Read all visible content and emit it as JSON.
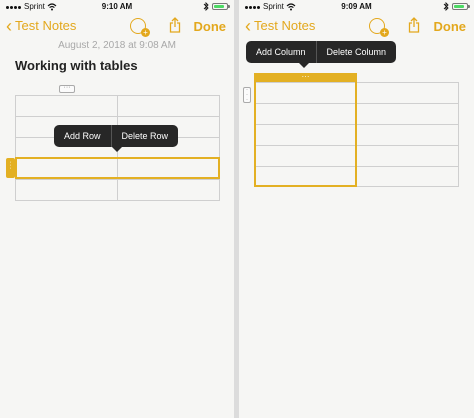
{
  "left": {
    "status": {
      "carrier": "Sprint",
      "time": "9:10 AM",
      "battery_level": 0.85
    },
    "nav": {
      "back_label": "Test Notes",
      "done_label": "Done"
    },
    "note": {
      "date": "August 2, 2018 at 9:08 AM",
      "title": "Working with tables"
    },
    "menu": {
      "add_row": "Add Row",
      "delete_row": "Delete Row"
    }
  },
  "right": {
    "status": {
      "carrier": "Sprint",
      "time": "9:09 AM",
      "battery_level": 0.85
    },
    "nav": {
      "back_label": "Test Notes",
      "done_label": "Done"
    },
    "menu": {
      "add_column": "Add Column",
      "delete_column": "Delete Column"
    }
  },
  "colors": {
    "accent": "#e3a81d",
    "selection": "#e3b023",
    "menu_bg": "#272727",
    "battery": "#4cd964"
  },
  "icons": [
    "back-chevron-icon",
    "add-people-icon",
    "share-icon",
    "wifi-icon",
    "bluetooth-icon",
    "battery-icon",
    "table-grip-icon"
  ]
}
